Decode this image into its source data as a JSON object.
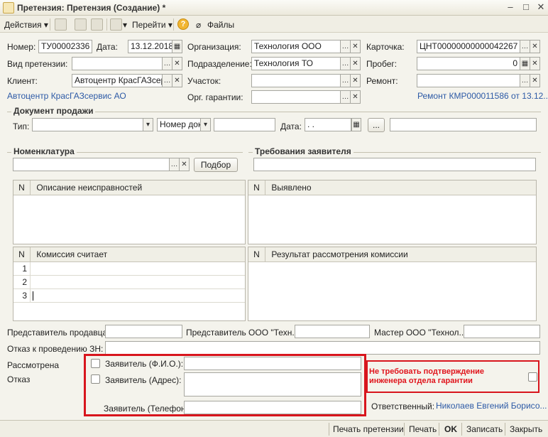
{
  "window": {
    "title": "Претензия: Претензия (Создание) *"
  },
  "toolbar": {
    "actions": "Действия",
    "goto": "Перейти",
    "files": "Файлы"
  },
  "form": {
    "number_label": "Номер:",
    "number": "ТУ00002336",
    "date_label": "Дата:",
    "date": "13.12.2018",
    "org_label": "Организация:",
    "org": "Технология ООО",
    "card_label": "Карточка:",
    "card": "ЦНТ00000000000042267",
    "claim_type_label": "Вид претензии:",
    "claim_type": "",
    "division_label": "Подразделение:",
    "division": "Технология ТО",
    "mileage_label": "Пробег:",
    "mileage": "0",
    "client_label": "Клиент:",
    "client": "Автоцентр КрасГАЗсерв",
    "section_label": "Участок:",
    "section": "",
    "repair_label": "Ремонт:",
    "repair": "",
    "client_link": "Автоцентр КрасГАЗсервис АО",
    "warranty_org_label": "Орг. гарантии:",
    "warranty_org": "",
    "repair_link": "Ремонт КМР000011586 от 13.12...."
  },
  "sale_doc": {
    "title": "Документ продажи",
    "type_label": "Тип:",
    "type": "",
    "number_placeholder": "Номер док-",
    "date_label": "Дата:",
    "date": " .  .",
    "btn": "..."
  },
  "nomenclature": {
    "title": "Номенклатура",
    "pick_button": "Подбор"
  },
  "requirements": {
    "title": "Требования заявителя"
  },
  "tables": {
    "faults": {
      "n": "N",
      "col": "Описание неисправностей"
    },
    "detected": {
      "n": "N",
      "col": "Выявлено"
    },
    "commission": {
      "n": "N",
      "col": "Комиссия считает",
      "rows": [
        "1",
        "2",
        "3"
      ]
    },
    "result": {
      "n": "N",
      "col": "Результат рассмотрения комиссии"
    }
  },
  "bottom": {
    "seller_rep_label": "Представитель продавца:",
    "ooo_rep_label": "Представитель ООО \"Техн...",
    "master_label": "Мастер ООО \"Технол...",
    "refusal_label": "Отказ к проведению ЗН:",
    "reviewed_label": "Рассмотрена",
    "refused_label": "Отказ",
    "applicant_name_label": "Заявитель (Ф.И.О.):",
    "applicant_address_label": "Заявитель (Адрес):",
    "applicant_phone_label": "Заявитель (Телефон):",
    "no_confirm_label": "Не требовать подтверждение инженера отдела гарантии",
    "responsible_label": "Ответственный:",
    "responsible": "Николаев Евгений Борисо..."
  },
  "footer": {
    "print_claim": "Печать претензии",
    "print": "Печать",
    "ok": "OK",
    "save": "Записать",
    "close": "Закрыть"
  }
}
